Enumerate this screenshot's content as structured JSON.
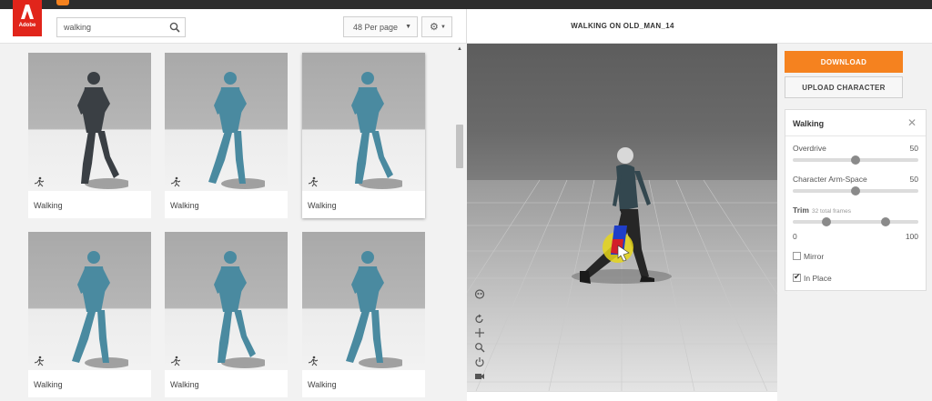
{
  "brand": {
    "logo_text": "Adobe"
  },
  "search": {
    "value": "walking"
  },
  "toolbar": {
    "per_page": "48 Per page"
  },
  "viewport": {
    "title": "WALKING ON OLD_MAN_14"
  },
  "actions": {
    "download": "DOWNLOAD",
    "upload": "UPLOAD CHARACTER"
  },
  "settings": {
    "title": "Walking",
    "overdrive": {
      "label": "Overdrive",
      "value": "50",
      "level": 0.5
    },
    "arm_space": {
      "label": "Character Arm-Space",
      "value": "50",
      "level": 0.5
    },
    "trim": {
      "label": "Trim",
      "sub": "32 total frames",
      "min": "0",
      "max": "100",
      "start": 0.27,
      "end": 0.74
    },
    "mirror": {
      "label": "Mirror",
      "checked": false
    },
    "in_place": {
      "label": "In Place",
      "checked": true
    }
  },
  "animations": [
    {
      "label": "Walking",
      "selected": false,
      "character": "soldier"
    },
    {
      "label": "Walking",
      "selected": false,
      "character": "mannequin"
    },
    {
      "label": "Walking",
      "selected": true,
      "character": "mannequin"
    },
    {
      "label": "Walking",
      "selected": false,
      "character": "mannequin"
    },
    {
      "label": "Walking",
      "selected": false,
      "character": "mannequin"
    },
    {
      "label": "Walking",
      "selected": false,
      "character": "mannequin"
    }
  ],
  "colors": {
    "accent": "#f5821f",
    "brand_red": "#e1251b",
    "mannequin": "#4a8aa0",
    "soldier": "#3a3f44"
  }
}
